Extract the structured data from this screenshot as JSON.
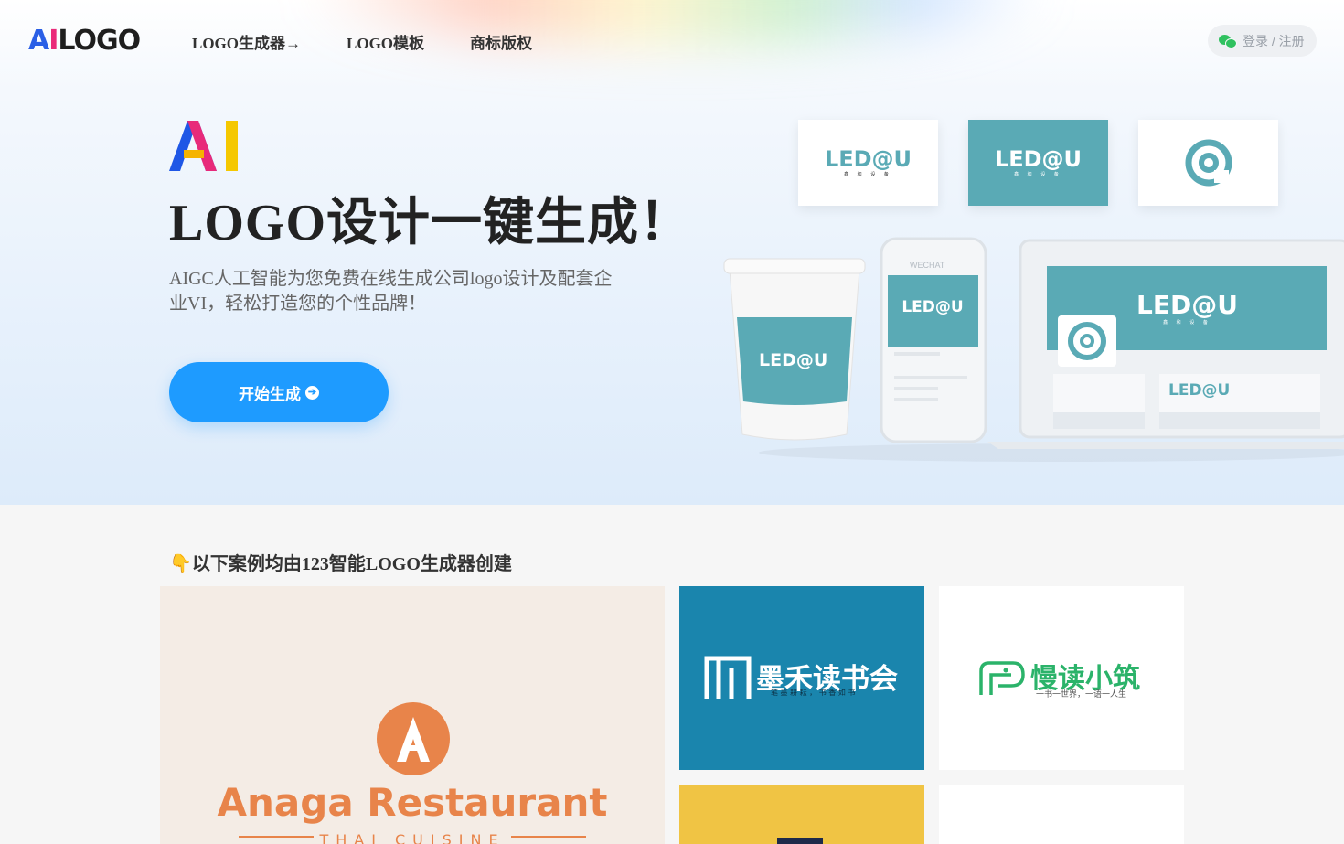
{
  "header": {
    "brand": {
      "part_a": "A",
      "part_i": "I",
      "part_logo": "LOGO"
    },
    "nav": [
      {
        "label": "LOGO生成器→"
      },
      {
        "label": "LOGO模板"
      },
      {
        "label": "商标版权"
      }
    ],
    "login_label": "登录 / 注册"
  },
  "hero": {
    "mark": "AI",
    "headline": "LOGO设计一键生成！",
    "subline": "AIGC人工智能为您免费在线生成公司logo设计及配套企业VI，轻松打造您的个性品牌！",
    "cta_label": "开始生成",
    "mockup": {
      "brand": "LED@U",
      "tagline": "鑫 和 设 备",
      "phone_label": "WECHAT",
      "accent_color": "#5aaab5"
    }
  },
  "showcase": {
    "title": "以下案例均由123智能LOGO生成器创建",
    "tiles": [
      {
        "name": "Anaga Restaurant",
        "sub": "THAI CUISINE",
        "mark": "A",
        "bg": "#f4ece5",
        "color": "#e8844a"
      },
      {
        "name": "墨禾读书会",
        "sub": "笔 墨 耕 耘 ， 书 香 如 书",
        "bg": "#1a85ad",
        "color": "#ffffff"
      },
      {
        "name": "慢读小筑",
        "sub": "一书一世界，一语一人生",
        "bg": "#ffffff",
        "color": "#2bb36a"
      }
    ]
  }
}
